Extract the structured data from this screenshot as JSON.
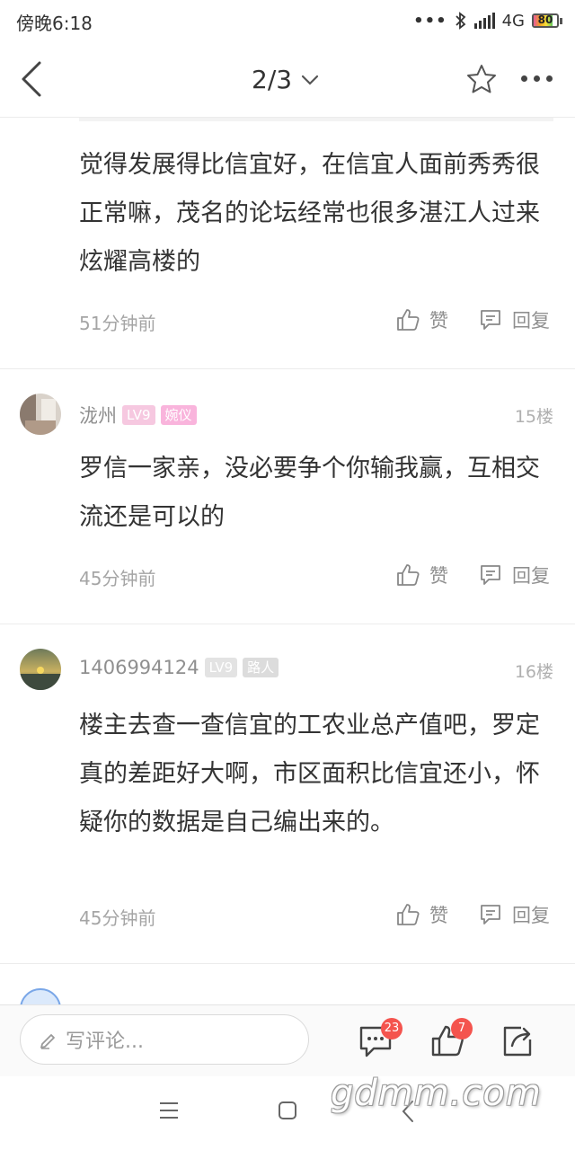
{
  "status_bar": {
    "time": "傍晚6:18",
    "network": "4G",
    "battery": "80"
  },
  "nav": {
    "page_indicator": "2/3"
  },
  "comments": [
    {
      "text": "觉得发展得比信宜好，在信宜人面前秀秀很正常嘛，茂名的论坛经常也很多湛江人过来炫耀高楼的",
      "time": "51分钟前",
      "like_label": "赞",
      "reply_label": "回复"
    },
    {
      "username": "泷州",
      "level": "LV9",
      "title_badge": "婉仪",
      "floor": "15楼",
      "text": "罗信一家亲，没必要争个你输我赢，互相交流还是可以的",
      "time": "45分钟前",
      "like_label": "赞",
      "reply_label": "回复"
    },
    {
      "username": "1406994124",
      "level": "LV9",
      "title_badge": "路人",
      "floor": "16楼",
      "text": "楼主去查一查信宜的工农业总产值吧，罗定 真的差距好大啊，市区面积比信宜还小，怀疑你的数据是自己编出来的。",
      "time": "45分钟前",
      "like_label": "赞",
      "reply_label": "回复"
    }
  ],
  "bottom_bar": {
    "comment_placeholder": "写评论...",
    "comment_count": "23",
    "like_count": "7"
  },
  "watermark": "gdmm.com"
}
